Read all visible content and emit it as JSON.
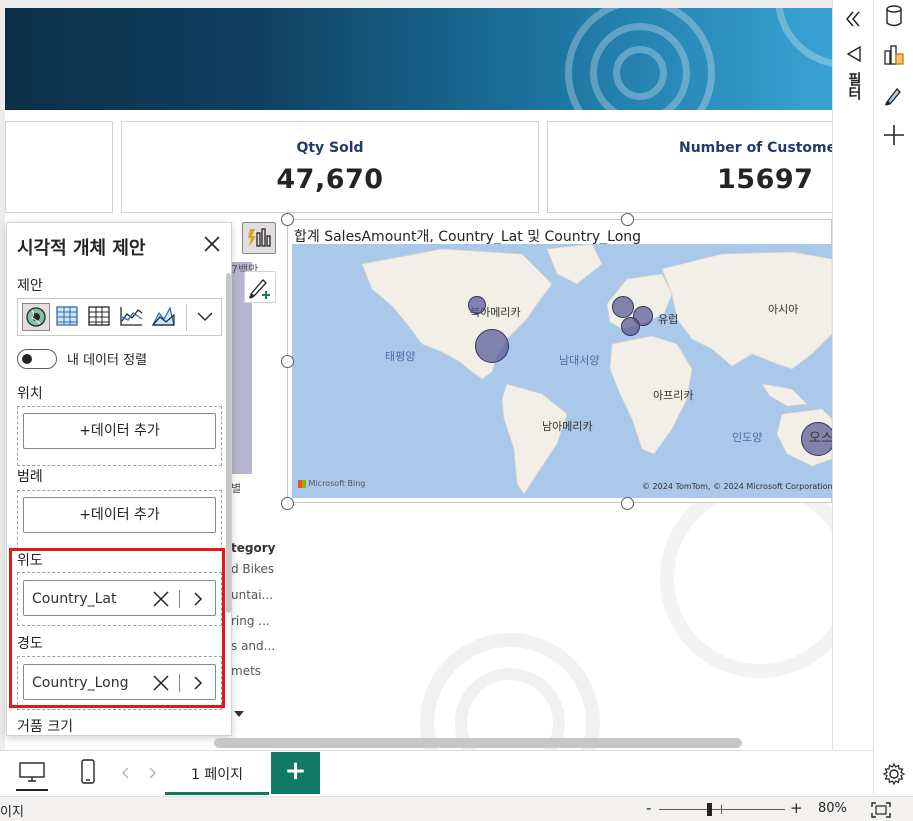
{
  "cards": [
    {
      "title": "",
      "value": ""
    },
    {
      "title": "Qty Sold",
      "value": "47,670"
    },
    {
      "title": "Number of Custome",
      "value": "15697"
    }
  ],
  "map_visual": {
    "title": "합계 SalesAmount개, Country_Lat 및 Country_Long",
    "labels": {
      "north_america": "북아메리카",
      "pacific": "태평양",
      "atlantic": "남대서양",
      "europe": "유럽",
      "asia": "아시아",
      "africa": "아프리카",
      "south_america": "남아메리카",
      "indian": "인도양",
      "oceania": "오스"
    },
    "bing_logo": "Microsoft Bing",
    "copyright": "© 2024 TomTom, © 2024 Microsoft Corporation"
  },
  "background_visual": {
    "fragment": "7백만",
    "category_header": "tegory",
    "categories": [
      "d Bikes",
      "untai...",
      "ring ...",
      "s and...",
      "mets"
    ],
    "axis_fragment": "별"
  },
  "suggestion_pane": {
    "title": "시각적 개체 제안",
    "suggest_label": "제안",
    "toggle_label": "내 데이터 정렬",
    "location_label": "위치",
    "legend_label": "범례",
    "add_data": "+데이터 추가",
    "latitude_label": "위도",
    "latitude_field": "Country_Lat",
    "longitude_label": "경도",
    "longitude_field": "Country_Long",
    "bubble_size_label": "거품 크기"
  },
  "right_panel": {
    "filter_label": "필터"
  },
  "tabs": {
    "page_tab": "1 페이지",
    "add_page": "+"
  },
  "status": {
    "page_text": "이지",
    "zoom_minus": "-",
    "zoom_plus": "+",
    "zoom_level": "80%",
    "zoom_fraction": 0.4
  },
  "colors": {
    "accent": "#117865",
    "bubble": "#5a5a96",
    "highlight": "#e01818",
    "kpi_title": "#1f3b70"
  }
}
